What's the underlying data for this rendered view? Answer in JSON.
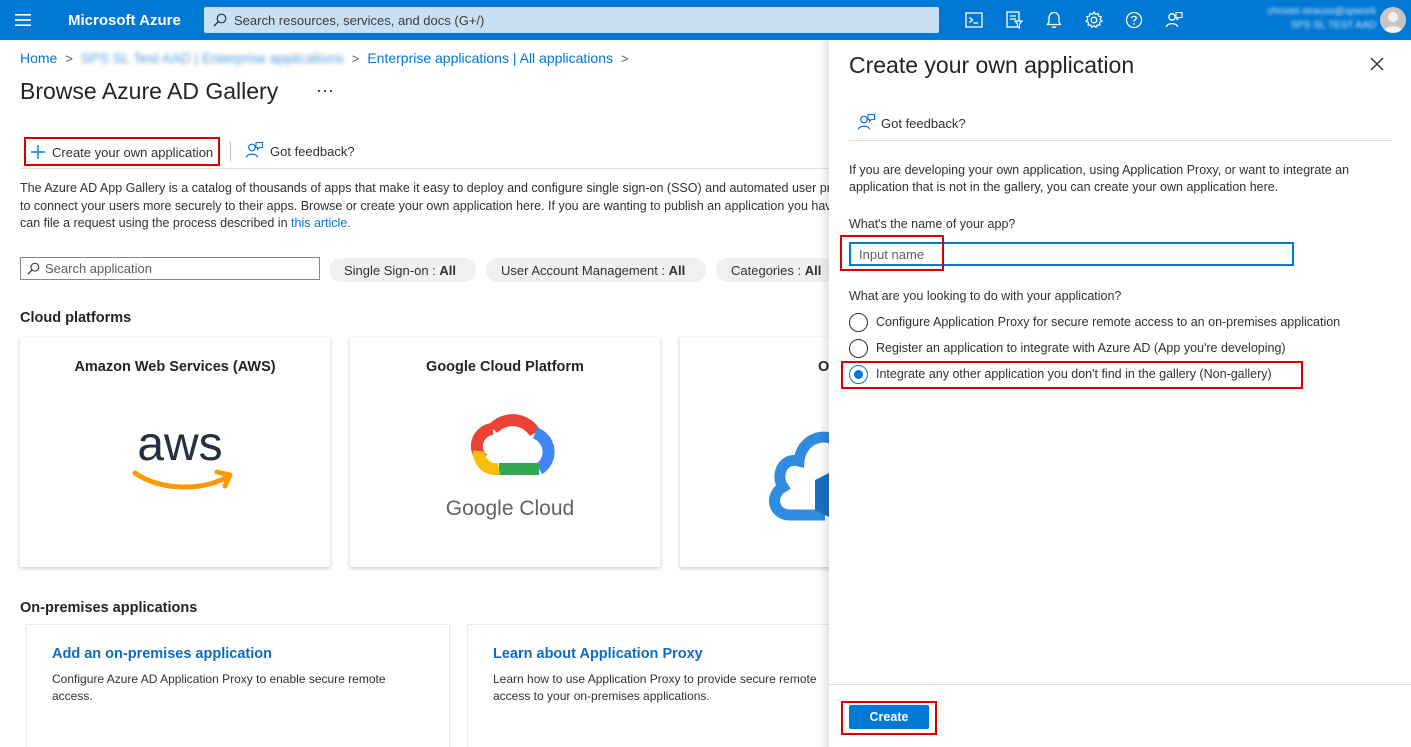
{
  "topbar": {
    "brand": "Microsoft Azure",
    "search_placeholder": "Search resources, services, and docs (G+/)",
    "account_line1": "christel.strauss@spwork",
    "account_line2": "SPS SL TEST AAD",
    "icons": [
      "cloud-shell-icon",
      "directory-filter-icon",
      "notifications-icon",
      "settings-icon",
      "help-icon",
      "feedback-icon"
    ]
  },
  "breadcrumb": {
    "home": "Home",
    "tenant": "SPS SL Test AAD | Enterprise applications",
    "enterprise": "Enterprise applications | All applications"
  },
  "page": {
    "title": "Browse Azure AD Gallery",
    "more": "···"
  },
  "toolbar": {
    "create_label": "Create your own application",
    "feedback_label": "Got feedback?"
  },
  "description": {
    "line1": "The Azure AD App Gallery is a catalog of thousands of apps that make it easy to deploy and configure single sign-on (SSO) and automated user provisioning",
    "line2": "to connect your users more securely to their apps. Browse or create your own application here. If you are wanting to publish an application you have developed, you",
    "line3_prefix": "can file a request using the process described in",
    "line3_link": "this article."
  },
  "filters": {
    "search_placeholder": "Search application",
    "sso_label": "Single Sign-on :",
    "sso_value": "All",
    "uam_label": "User Account Management :",
    "uam_value": "All",
    "cat_label": "Categories :",
    "cat_value": "All"
  },
  "cloud": {
    "heading": "Cloud platforms",
    "cards": [
      {
        "name": "Amazon Web Services (AWS)",
        "logo_text": "aws"
      },
      {
        "name": "Google Cloud Platform",
        "logo_text": "Google Cloud"
      },
      {
        "name": "O"
      }
    ]
  },
  "onprem": {
    "heading": "On-premises applications",
    "cards": [
      {
        "title": "Add an on-premises application",
        "desc": "Configure Azure AD Application Proxy to enable secure remote access."
      },
      {
        "title": "Learn about Application Proxy",
        "desc": "Learn how to use Application Proxy to provide secure remote access to your on-premises applications."
      }
    ]
  },
  "panel": {
    "title": "Create your own application",
    "feedback_label": "Got feedback?",
    "description": "If you are developing your own application, using Application Proxy, or want to integrate an application that is not in the gallery, you can create your own application here.",
    "name_question": "What's the name of your app?",
    "name_value": "",
    "name_placeholder": "Input name",
    "purpose_question": "What are you looking to do with your application?",
    "options": [
      {
        "label": "Configure Application Proxy for secure remote access to an on-premises application",
        "selected": false
      },
      {
        "label": "Register an application to integrate with Azure AD (App you're developing)",
        "selected": false
      },
      {
        "label": "Integrate any other application you don't find in the gallery (Non-gallery)",
        "selected": true
      }
    ],
    "create_label": "Create"
  },
  "colors": {
    "azure_blue": "#0078d4",
    "highlight_red": "#d50000"
  }
}
